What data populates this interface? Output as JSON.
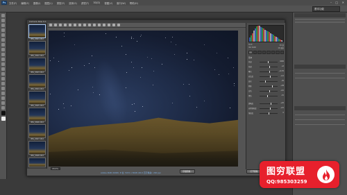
{
  "app": {
    "logo": "Ps"
  },
  "menubar": {
    "items": [
      "文件(F)",
      "编辑(E)",
      "图像(I)",
      "图层(L)",
      "类型(Y)",
      "选择(S)",
      "滤镜(T)",
      "3D(D)",
      "视图(V)",
      "窗口(W)",
      "帮助(H)"
    ]
  },
  "window_controls": {
    "minimize": "–",
    "maximize": "□",
    "close": "✕"
  },
  "options_bar": {
    "workspace": "基本功能"
  },
  "dialog": {
    "title": "Camera Raw 9.1",
    "film_labels": [
      "IMG_0601.CR2",
      "IMG_0602.CR2",
      "IMG_0603.CR2",
      "IMG_0604.CR2",
      "IMG_0605.CR2",
      "IMG_0606.CR2",
      "IMG_0607.CR2",
      "IMG_0608.CR2",
      "IMG_0609.CR2"
    ],
    "zoom": "18.2%",
    "info_link": "Adobe RGB (1998); 8 位; 5472 x 3648 (20.0 百万像素); 240 ppi",
    "buttons": {
      "save": "存储图像...",
      "open": "打开图像",
      "cancel": "取消",
      "done": "完成"
    }
  },
  "right_panel": {
    "camera": {
      "f": "f/2.8",
      "shutter": "30 秒",
      "iso": "ISO 6400",
      "focal": "16 毫米"
    },
    "section_title": "基本",
    "sliders": [
      {
        "label": "色温",
        "value": "4200",
        "level": 0.45
      },
      {
        "label": "色调",
        "value": "+6",
        "level": 0.52
      },
      {
        "label": "曝光",
        "value": "+0.35",
        "level": 0.55
      },
      {
        "label": "对比度",
        "value": "+12",
        "level": 0.56
      },
      {
        "label": "高光",
        "value": "-45",
        "level": 0.3
      },
      {
        "label": "阴影",
        "value": "+38",
        "level": 0.7
      },
      {
        "label": "白色",
        "value": "+10",
        "level": 0.55
      },
      {
        "label": "黑色",
        "value": "-15",
        "level": 0.42
      },
      {
        "label": "清晰度",
        "value": "+25",
        "level": 0.62
      },
      {
        "label": "自然饱和度",
        "value": "+15",
        "level": 0.58
      },
      {
        "label": "饱和度",
        "value": "0",
        "level": 0.5
      }
    ]
  },
  "watermark": {
    "title": "图穷联盟",
    "qq": "QQ:985303259"
  }
}
